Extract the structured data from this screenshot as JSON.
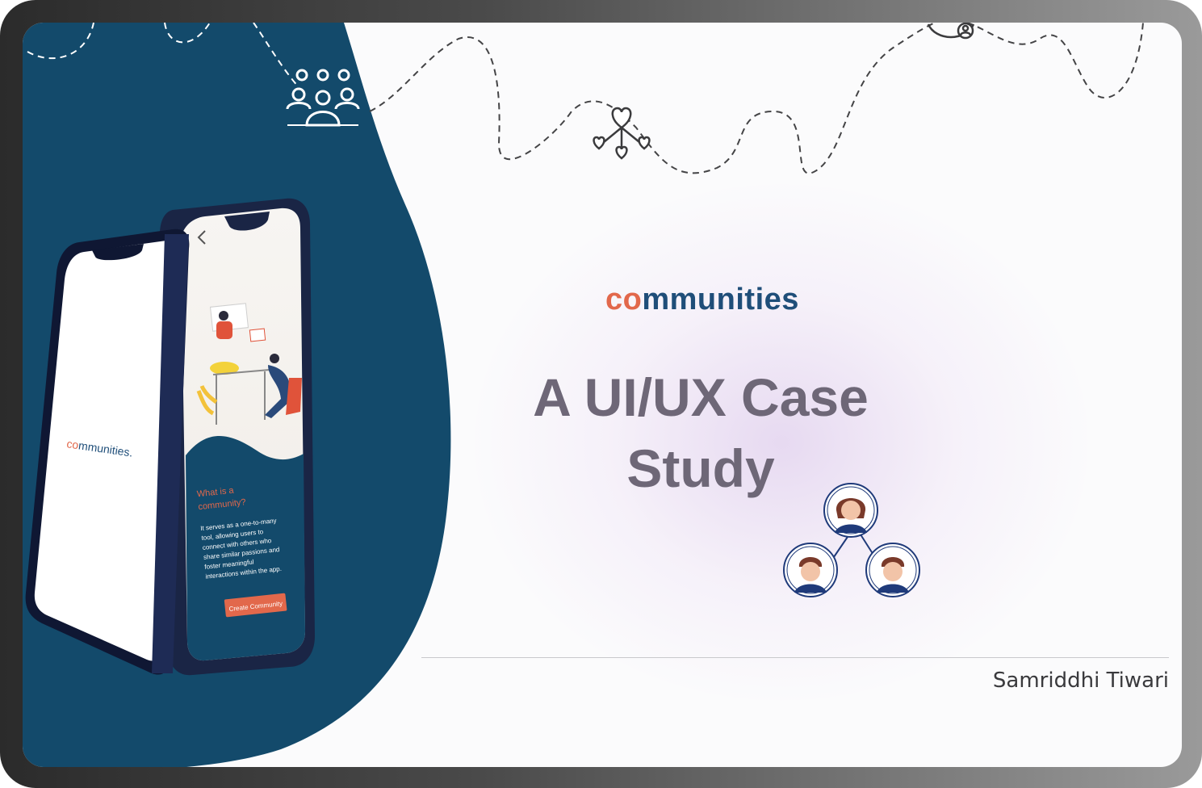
{
  "brand": {
    "co": "co",
    "rest": "mmunities"
  },
  "hero": {
    "line1": "A UI/UX Case",
    "line2": "Study"
  },
  "author": "Samriddhi Tiwari",
  "phone_left": {
    "logo_co": "co",
    "logo_rest": "mmunities."
  },
  "phone_right": {
    "heading_line1": "What is a",
    "heading_line2": "community?",
    "body_lines": [
      "It serves as a one-to-many",
      "tool, allowing users to",
      "connect with others who",
      "share similar passions and",
      "foster meaningful",
      "interactions within the app."
    ],
    "cta": "Create Community"
  },
  "colors": {
    "navy": "#134a6b",
    "accent": "#e2684b",
    "brand_blue": "#1f4e79",
    "title_gray": "#6e6777"
  },
  "icons": [
    "group-icon",
    "hearts-network-icon",
    "people-network-icon",
    "globe-user-icon",
    "back-arrow-icon"
  ]
}
